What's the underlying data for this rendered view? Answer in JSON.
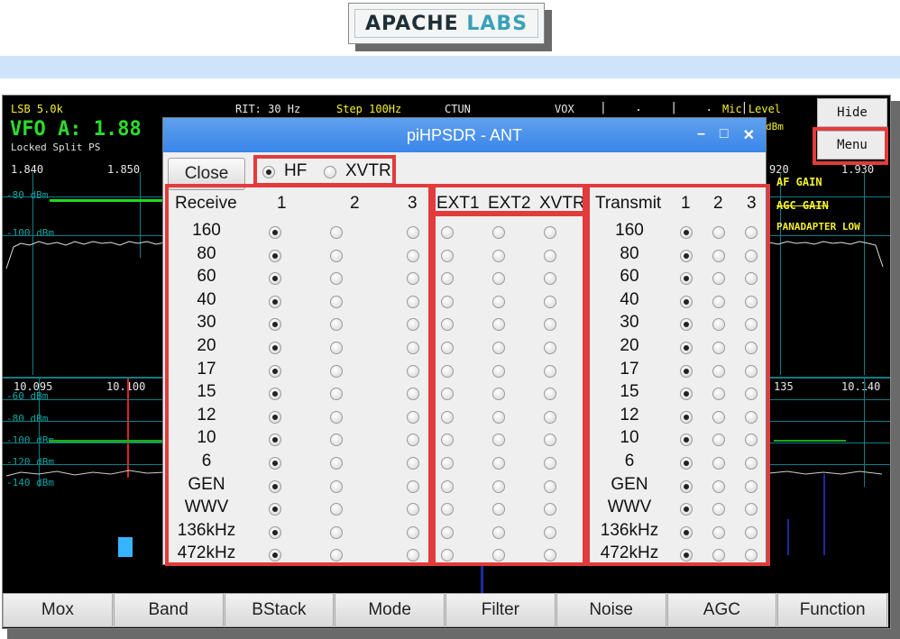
{
  "logo": {
    "apache": "APACHE",
    "labs": "LABS"
  },
  "sdr": {
    "status_top": {
      "mode": "LSB 5.0k",
      "rit": "RIT: 30 Hz",
      "step": "Step 100Hz",
      "ctun": "CTUN",
      "vox": "VOX",
      "mic_level": "Mic Level",
      "dbm": "dBm"
    },
    "vfo": {
      "label": "VFO A: 1.88",
      "sub": "Locked Split  PS"
    },
    "upper_freqs": [
      "1.840",
      "1.850",
      "920",
      "1.930"
    ],
    "upper_dbm": [
      "-80 dBm",
      "-100 dBm"
    ],
    "right_labels": [
      "AF GAIN",
      "AGC GAIN",
      "PANADAPTER LOW"
    ],
    "lower_freqs": [
      "10.095",
      "10.100",
      "135",
      "10.140"
    ],
    "lower_dbm": [
      "-60 dBm",
      "-80 dBm",
      "-100 dBm",
      "-120 dBm",
      "-140 dBm"
    ],
    "hide_button": "Hide",
    "menu_button": "Menu"
  },
  "bottom_buttons": [
    "Mox",
    "Band",
    "BStack",
    "Mode",
    "Filter",
    "Noise",
    "AGC",
    "Function"
  ],
  "dialog": {
    "title": "piHPSDR - ANT",
    "close_label": "Close",
    "hf_label": "HF",
    "xvtr_label": "XVTR",
    "hf_selected": true,
    "receive_header": "Receive",
    "rx_cols": [
      "1",
      "2",
      "3"
    ],
    "ext_cols": [
      "EXT1",
      "EXT2",
      "XVTR"
    ],
    "transmit_header": "Transmit",
    "tx_cols": [
      "1",
      "2",
      "3"
    ],
    "bands": [
      "160",
      "80",
      "60",
      "40",
      "30",
      "20",
      "17",
      "15",
      "12",
      "10",
      "6",
      "GEN",
      "WWV",
      "136kHz",
      "472kHz"
    ],
    "rx_selected_col": 1,
    "tx_selected_col": 1
  },
  "colors": {
    "highlight": "#e23b3b",
    "title_bar": "#3a86ea",
    "vfo_green": "#2cdc2c"
  }
}
